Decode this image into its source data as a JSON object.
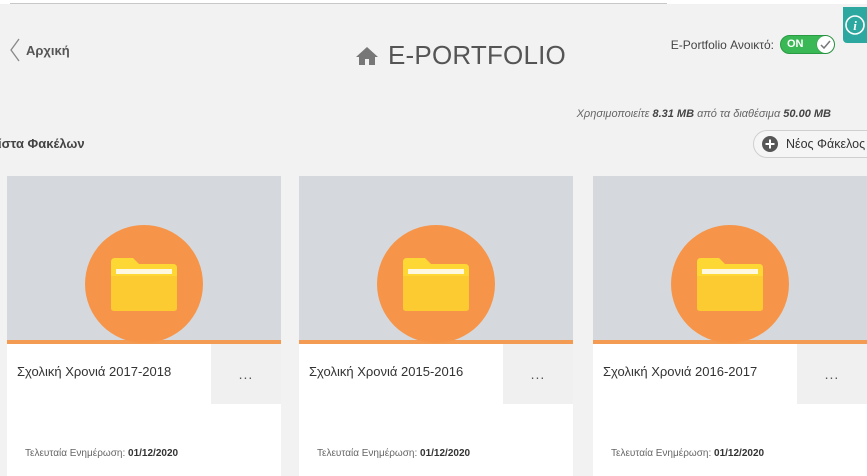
{
  "header": {
    "back_label": "Αρχική",
    "title": "E-PORTFOLIO",
    "toggle_label": "E-Portfolio Ανοικτό:",
    "toggle_state": "ON",
    "info_icon": "i"
  },
  "usage": {
    "prefix": "Χρησιμοποιείτε",
    "used": "8.31 MB",
    "middle": "από τα διαθέσιμα",
    "total": "50.00 MB"
  },
  "folders_section": {
    "title": "ίστα Φακέλων",
    "new_folder_label": "Νέος Φάκελος"
  },
  "folders": [
    {
      "name": "Σχολική Χρονιά 2017-2018",
      "menu": "...",
      "updated_label": "Τελευταία Ενημέρωση:",
      "updated_value": "01/12/2020"
    },
    {
      "name": "Σχολική Χρονιά 2015-2016",
      "menu": "...",
      "updated_label": "Τελευταία Ενημέρωση:",
      "updated_value": "01/12/2020"
    },
    {
      "name": "Σχολική Χρονιά 2016-2017",
      "menu": "...",
      "updated_label": "Τελευταία Ενημέρωση:",
      "updated_value": "01/12/2020"
    }
  ],
  "colors": {
    "accent_orange": "#f6954a",
    "toggle_green": "#3ab855",
    "folder_yellow": "#fdd835",
    "info_teal": "#2ca8a0"
  }
}
